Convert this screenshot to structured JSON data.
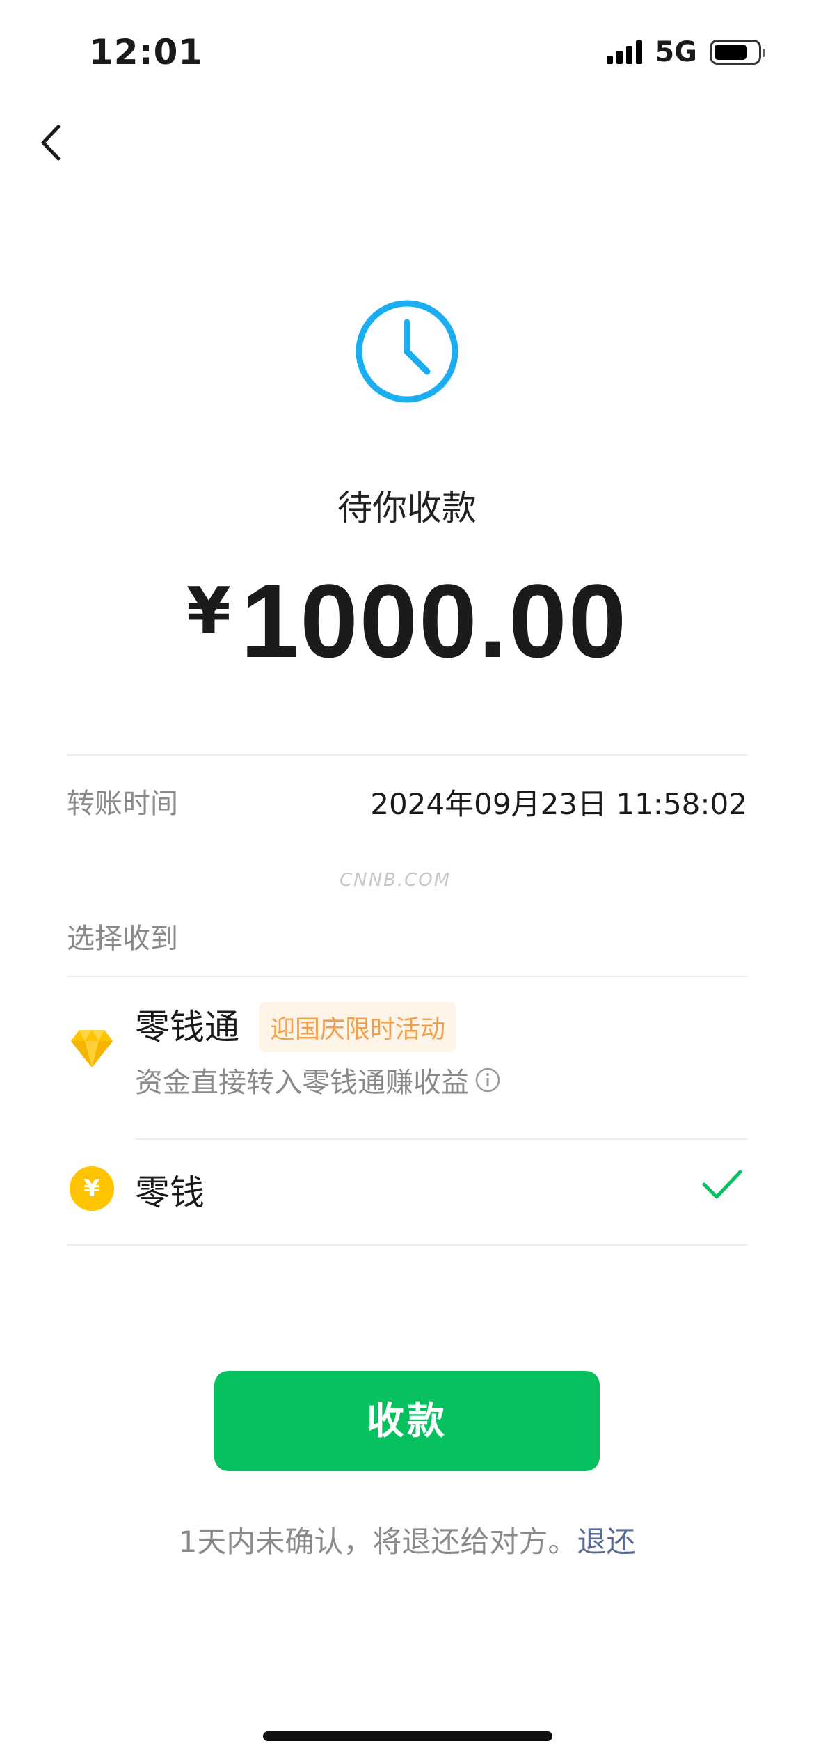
{
  "status_bar": {
    "time": "12:01",
    "network": "5G",
    "signal_icon": "cellular-signal-icon",
    "battery_icon": "battery-icon"
  },
  "nav": {
    "back_icon": "chevron-left-icon"
  },
  "status": {
    "icon": "clock-icon",
    "title": "待你收款"
  },
  "amount": {
    "currency": "¥",
    "value": "1000.00"
  },
  "transfer": {
    "label": "转账时间",
    "value": "2024年09月23日 11:58:02"
  },
  "watermark": "CNNB.COM",
  "receive_to": {
    "label": "选择收到",
    "options": [
      {
        "name": "零钱通",
        "icon": "diamond-icon",
        "badge": "迎国庆限时活动",
        "description": "资金直接转入零钱通赚收益",
        "info_icon": "info-icon",
        "selected": false
      },
      {
        "name": "零钱",
        "icon": "yen-coin-icon",
        "coin_symbol": "¥",
        "selected": true,
        "check_icon": "checkmark-icon"
      }
    ]
  },
  "button": {
    "label": "收款"
  },
  "footer": {
    "note": "1天内未确认，将退还给对方。",
    "link": "退还"
  },
  "colors": {
    "accent_green": "#07c160",
    "clock_blue": "#1aadf2",
    "link_blue": "#576b95",
    "promo_orange": "#f0a04b",
    "coin_yellow": "#ffc300"
  }
}
